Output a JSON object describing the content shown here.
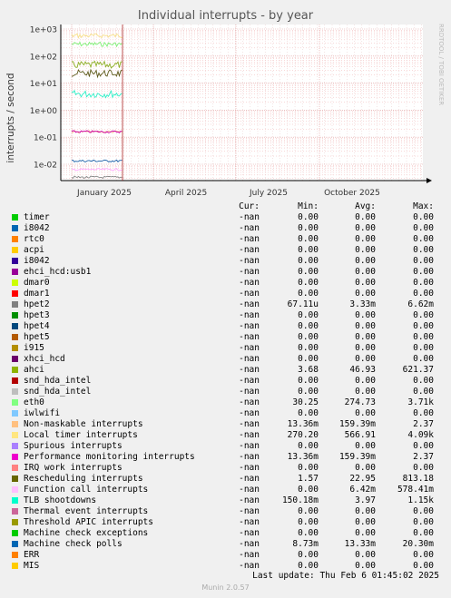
{
  "chart_data": {
    "type": "line",
    "title": "Individual interrupts - by year",
    "ylabel": "interrupts / second",
    "yscale": "log",
    "ylim": [
      0.004,
      1000
    ],
    "yticks": [
      "1e+03",
      "1e+02",
      "1e+01",
      "1e+00",
      "1e-01",
      "1e-02"
    ],
    "xticks": [
      "January 2025",
      "April 2025",
      "July 2025",
      "October 2025"
    ],
    "grid": true,
    "series": [
      {
        "name": "eth0",
        "color": "#7cf074",
        "approx_level": 274.73
      },
      {
        "name": "Local timer interrupts",
        "color": "#f7e08a",
        "approx_level": 566.91
      },
      {
        "name": "Rescheduling interrupts",
        "color": "#5e5a1c",
        "approx_level": 22.95
      },
      {
        "name": "ahci",
        "color": "#8cb026",
        "approx_level": 46.93
      },
      {
        "name": "TLB shootdowns",
        "color": "#2cf0c8",
        "approx_level": 3.97
      },
      {
        "name": "Non-maskable interrupts",
        "color": "#f7b48a",
        "approx_level": 0.159
      },
      {
        "name": "Performance monitoring interrupts",
        "color": "#cc00aa",
        "approx_level": 0.159
      },
      {
        "name": "Machine check polls",
        "color": "#1b5fa8",
        "approx_level": 0.0133
      },
      {
        "name": "Function call interrupts",
        "color": "#ffaaff",
        "approx_level": 0.0064
      },
      {
        "name": "hpet2",
        "color": "#888888",
        "approx_level": 0.0033
      }
    ]
  },
  "side_label": "RRDTOOL / TOBI OETIKER",
  "legend": {
    "headers": {
      "cur": "Cur:",
      "min": "Min:",
      "avg": "Avg:",
      "max": "Max:"
    },
    "rows": [
      {
        "name": "timer",
        "color": "#00cc00",
        "cur": "-nan",
        "min": "0.00",
        "avg": "0.00",
        "max": "0.00"
      },
      {
        "name": "i8042",
        "color": "#0066b3",
        "cur": "-nan",
        "min": "0.00",
        "avg": "0.00",
        "max": "0.00"
      },
      {
        "name": "rtc0",
        "color": "#ff8000",
        "cur": "-nan",
        "min": "0.00",
        "avg": "0.00",
        "max": "0.00"
      },
      {
        "name": "acpi",
        "color": "#ffcc00",
        "cur": "-nan",
        "min": "0.00",
        "avg": "0.00",
        "max": "0.00"
      },
      {
        "name": "i8042",
        "color": "#330099",
        "cur": "-nan",
        "min": "0.00",
        "avg": "0.00",
        "max": "0.00"
      },
      {
        "name": "ehci_hcd:usb1",
        "color": "#990099",
        "cur": "-nan",
        "min": "0.00",
        "avg": "0.00",
        "max": "0.00"
      },
      {
        "name": "dmar0",
        "color": "#ccff00",
        "cur": "-nan",
        "min": "0.00",
        "avg": "0.00",
        "max": "0.00"
      },
      {
        "name": "dmar1",
        "color": "#ff0000",
        "cur": "-nan",
        "min": "0.00",
        "avg": "0.00",
        "max": "0.00"
      },
      {
        "name": "hpet2",
        "color": "#808080",
        "cur": "-nan",
        "min": "67.11u",
        "avg": "3.33m",
        "max": "6.62m"
      },
      {
        "name": "hpet3",
        "color": "#008f00",
        "cur": "-nan",
        "min": "0.00",
        "avg": "0.00",
        "max": "0.00"
      },
      {
        "name": "hpet4",
        "color": "#00487d",
        "cur": "-nan",
        "min": "0.00",
        "avg": "0.00",
        "max": "0.00"
      },
      {
        "name": "hpet5",
        "color": "#b35a00",
        "cur": "-nan",
        "min": "0.00",
        "avg": "0.00",
        "max": "0.00"
      },
      {
        "name": "i915",
        "color": "#b38f00",
        "cur": "-nan",
        "min": "0.00",
        "avg": "0.00",
        "max": "0.00"
      },
      {
        "name": "xhci_hcd",
        "color": "#6b006b",
        "cur": "-nan",
        "min": "0.00",
        "avg": "0.00",
        "max": "0.00"
      },
      {
        "name": "ahci",
        "color": "#8fb300",
        "cur": "-nan",
        "min": "3.68",
        "avg": "46.93",
        "max": "621.37"
      },
      {
        "name": "snd_hda_intel",
        "color": "#b30000",
        "cur": "-nan",
        "min": "0.00",
        "avg": "0.00",
        "max": "0.00"
      },
      {
        "name": "snd_hda_intel",
        "color": "#bebebe",
        "cur": "-nan",
        "min": "0.00",
        "avg": "0.00",
        "max": "0.00"
      },
      {
        "name": "eth0",
        "color": "#80ff80",
        "cur": "-nan",
        "min": "30.25",
        "avg": "274.73",
        "max": "3.71k"
      },
      {
        "name": "iwlwifi",
        "color": "#80c9ff",
        "cur": "-nan",
        "min": "0.00",
        "avg": "0.00",
        "max": "0.00"
      },
      {
        "name": "Non-maskable interrupts",
        "color": "#ffc080",
        "cur": "-nan",
        "min": "13.36m",
        "avg": "159.39m",
        "max": "2.37"
      },
      {
        "name": "Local timer interrupts",
        "color": "#ffe680",
        "cur": "-nan",
        "min": "270.20",
        "avg": "566.91",
        "max": "4.09k"
      },
      {
        "name": "Spurious interrupts",
        "color": "#aa80ff",
        "cur": "-nan",
        "min": "0.00",
        "avg": "0.00",
        "max": "0.00"
      },
      {
        "name": "Performance monitoring interrupts",
        "color": "#ee00cc",
        "cur": "-nan",
        "min": "13.36m",
        "avg": "159.39m",
        "max": "2.37"
      },
      {
        "name": "IRQ work interrupts",
        "color": "#ff8080",
        "cur": "-nan",
        "min": "0.00",
        "avg": "0.00",
        "max": "0.00"
      },
      {
        "name": "Rescheduling interrupts",
        "color": "#666600",
        "cur": "-nan",
        "min": "1.57",
        "avg": "22.95",
        "max": "813.18"
      },
      {
        "name": "Function call interrupts",
        "color": "#ffbfff",
        "cur": "-nan",
        "min": "0.00",
        "avg": "6.42m",
        "max": "578.41m"
      },
      {
        "name": "TLB shootdowns",
        "color": "#00ffcc",
        "cur": "-nan",
        "min": "150.18m",
        "avg": "3.97",
        "max": "1.15k"
      },
      {
        "name": "Thermal event interrupts",
        "color": "#cc6699",
        "cur": "-nan",
        "min": "0.00",
        "avg": "0.00",
        "max": "0.00"
      },
      {
        "name": "Threshold APIC interrupts",
        "color": "#999900",
        "cur": "-nan",
        "min": "0.00",
        "avg": "0.00",
        "max": "0.00"
      },
      {
        "name": "Machine check exceptions",
        "color": "#00cc00",
        "cur": "-nan",
        "min": "0.00",
        "avg": "0.00",
        "max": "0.00"
      },
      {
        "name": "Machine check polls",
        "color": "#0066b3",
        "cur": "-nan",
        "min": "8.73m",
        "avg": "13.33m",
        "max": "20.30m"
      },
      {
        "name": "ERR",
        "color": "#ff8000",
        "cur": "-nan",
        "min": "0.00",
        "avg": "0.00",
        "max": "0.00"
      },
      {
        "name": "MIS",
        "color": "#ffcc00",
        "cur": "-nan",
        "min": "0.00",
        "avg": "0.00",
        "max": "0.00"
      }
    ]
  },
  "last_update": "Last update: Thu Feb  6 01:45:02 2025",
  "version": "Munin 2.0.57"
}
